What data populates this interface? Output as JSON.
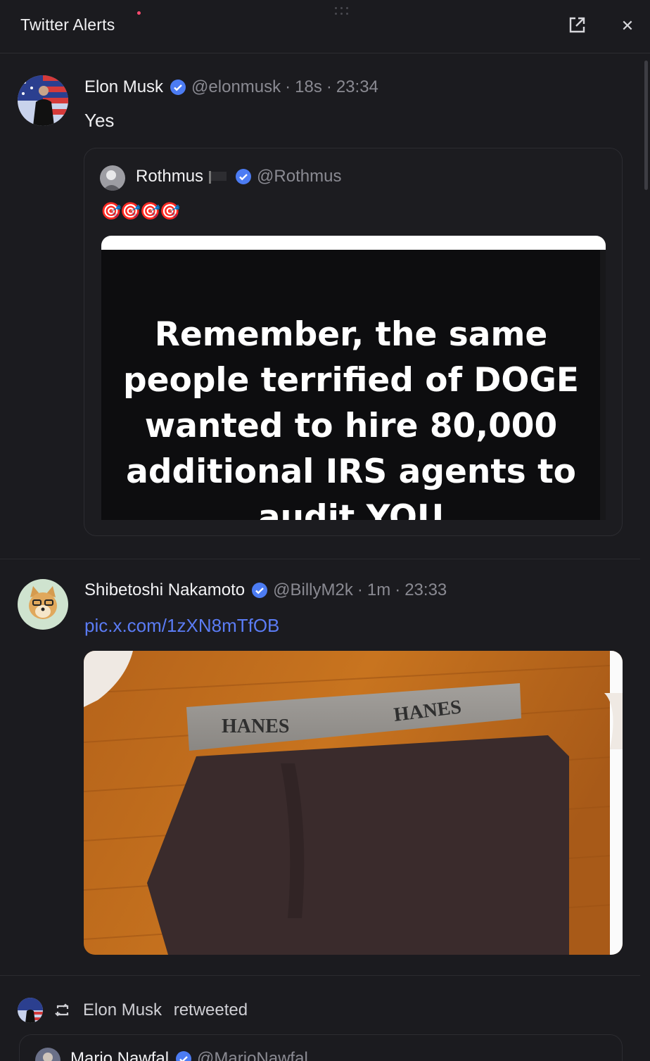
{
  "header": {
    "title": "Twitter Alerts",
    "open_external_icon": "external-link-icon",
    "close_icon": "close-icon",
    "close_glyph": "✕"
  },
  "tweets": [
    {
      "name": "Elon Musk",
      "handle": "@elonmusk",
      "age": "18s",
      "time": "23:34",
      "text": "Yes",
      "quote": {
        "name": "Rothmus",
        "handle": "@Rothmus",
        "emoji": "🎯🎯🎯🎯",
        "image_text": "Remember, the same people terrified of DOGE wanted to hire 80,000 additional IRS agents to audit YOU"
      }
    },
    {
      "name": "Shibetoshi Nakamoto",
      "handle": "@BillyM2k",
      "age": "1m",
      "time": "23:33",
      "link": "pic.x.com/1zXN8mTfOB",
      "image_labels": [
        "HANES",
        "HANES"
      ]
    }
  ],
  "retweet": {
    "user": "Elon Musk",
    "action": "retweeted",
    "next_name": "Mario Nawfal",
    "next_handle": "@MarioNawfal"
  },
  "colors": {
    "background": "#1b1b1f",
    "verified": "#4c7cf3",
    "link": "#5b7cf5",
    "muted": "#8a8a92"
  }
}
